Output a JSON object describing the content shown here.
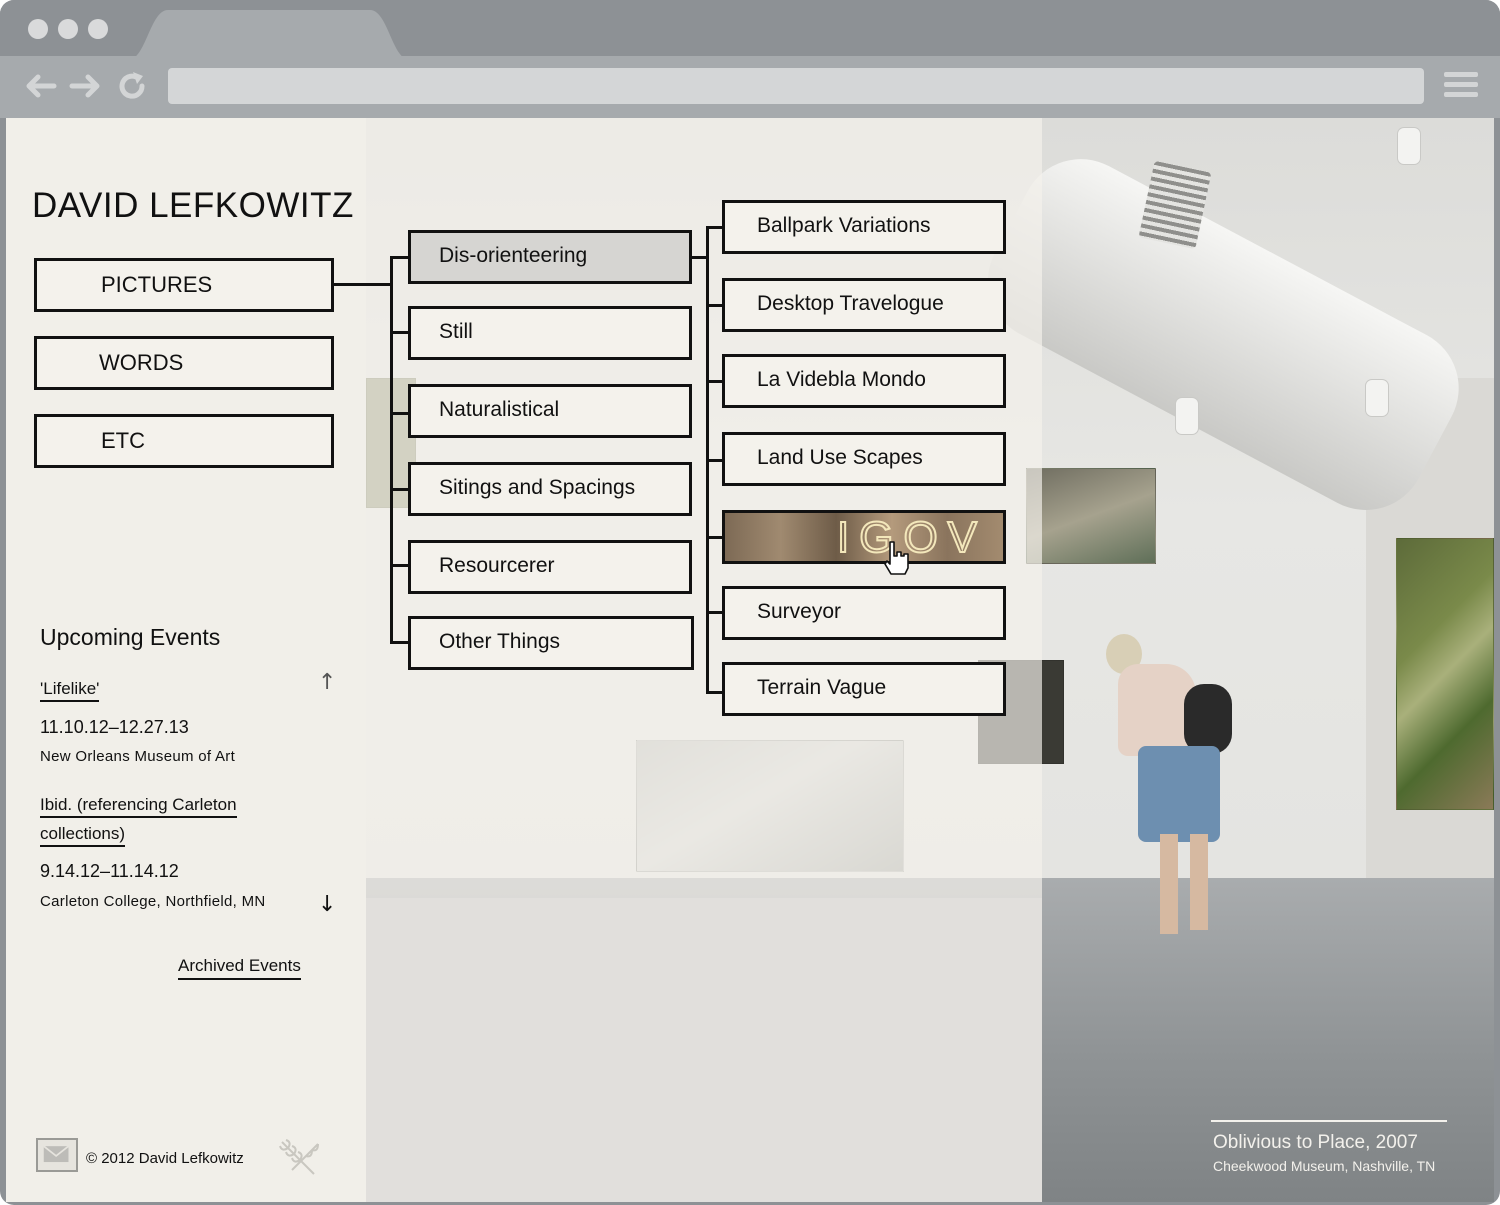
{
  "site": {
    "title": "DAVID LEFKOWITZ"
  },
  "nav": {
    "main": [
      {
        "label": "PICTURES",
        "active": true
      },
      {
        "label": "WORDS"
      },
      {
        "label": "ETC"
      }
    ],
    "pictures_submenu": [
      {
        "label": "Dis-orienteering",
        "active": true
      },
      {
        "label": "Still"
      },
      {
        "label": "Naturalistical"
      },
      {
        "label": "Sitings and Spacings"
      },
      {
        "label": "Resourcerer"
      },
      {
        "label": "Other Things"
      }
    ],
    "disorienteering_submenu": [
      {
        "label": "Ballpark Variations"
      },
      {
        "label": "Desktop Travelogue"
      },
      {
        "label": "La Videbla Mondo"
      },
      {
        "label": "Land Use Scapes"
      },
      {
        "label": "",
        "thumbnail": true,
        "hovered": true
      },
      {
        "label": "Surveyor"
      },
      {
        "label": "Terrain Vague"
      }
    ]
  },
  "events": {
    "heading": "Upcoming Events",
    "items": [
      {
        "title": "'Lifelike'",
        "dates": "11.10.12–12.27.13",
        "venue": "New Orleans Museum of Art"
      },
      {
        "title_line1": "Ibid. (referencing Carleton",
        "title_line2": "collections)",
        "dates": "9.14.12–11.14.12",
        "venue": "Carleton College, Northfield, MN"
      }
    ],
    "archived_link": "Archived Events"
  },
  "footer": {
    "copyright": "© 2012 David Lefkowitz"
  },
  "caption": {
    "title": "Oblivious to Place, 2007",
    "location": "Cheekwood Museum, Nashville, TN"
  },
  "icons": {
    "back": "back-arrow-icon",
    "forward": "forward-arrow-icon",
    "reload": "reload-icon",
    "menu": "hamburger-menu-icon",
    "mail": "mail-icon",
    "logo": "wheat-icon",
    "scroll_up": "up-arrow-icon",
    "scroll_down": "down-arrow-icon",
    "cursor": "hand-cursor-icon"
  },
  "colors": {
    "panel": "#f1efe9",
    "chrome": "#8d9195",
    "active_item": "#d6d5d2",
    "border": "#111111"
  }
}
